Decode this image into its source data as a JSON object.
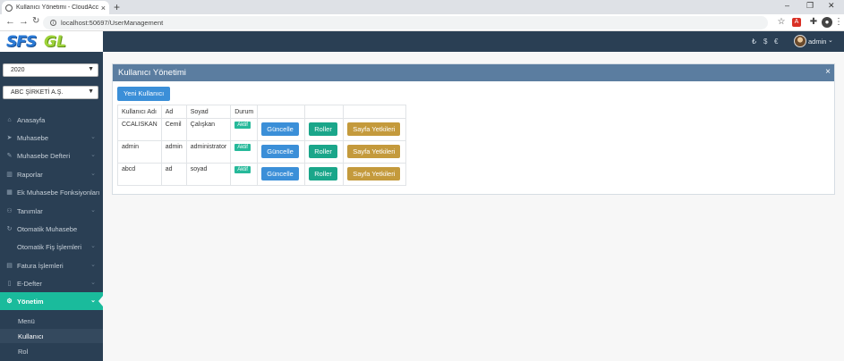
{
  "browser": {
    "tab_title": "Kullanıcı Yönetimi - CloudAccou",
    "tab_close": "×",
    "new_tab": "+",
    "url": "localhost:50697/UserManagement",
    "window_controls": [
      "–",
      "❐",
      "✕"
    ]
  },
  "brand": {
    "part1": "SFS",
    "part2": "GL"
  },
  "header": {
    "currencies": [
      "₺",
      "$",
      "€"
    ],
    "user": "admin"
  },
  "sidebar": {
    "year_select": "2020",
    "company_select": "ABC ŞİRKETİ A.Ş.",
    "items": [
      {
        "label": "Anasayfa",
        "icon": "home-icon",
        "has_arrow": false
      },
      {
        "label": "Muhasebe",
        "icon": "send-icon",
        "has_arrow": true
      },
      {
        "label": "Muhasebe Defteri",
        "icon": "pencil-icon",
        "has_arrow": true
      },
      {
        "label": "Raporlar",
        "icon": "bar-chart-icon",
        "has_arrow": true
      },
      {
        "label": "Ek Muhasebe Fonksiyonları",
        "icon": "table-icon",
        "has_arrow": false
      },
      {
        "label": "Tanımlar",
        "icon": "users-icon",
        "has_arrow": true
      },
      {
        "label": "Otomatik Muhasebe",
        "icon": "refresh-icon",
        "has_arrow": false
      },
      {
        "label": "Otomatik Fiş İşlemleri",
        "icon": "",
        "has_arrow": true
      },
      {
        "label": "Fatura İşlemleri",
        "icon": "file-icon",
        "has_arrow": true
      },
      {
        "label": "E-Defter",
        "icon": "book-icon",
        "has_arrow": true
      },
      {
        "label": "Yönetim",
        "icon": "cogs-icon",
        "has_arrow": true,
        "active": true
      }
    ],
    "subitems": [
      "Menü",
      "Kullanıcı",
      "Rol"
    ]
  },
  "panel": {
    "title": "Kullanıcı Yönetimi",
    "close": "×",
    "new_user_button": "Yeni Kullanıcı",
    "columns": [
      "Kullanıcı Adı",
      "Ad",
      "Soyad",
      "Durum",
      "",
      "",
      ""
    ],
    "rows": [
      {
        "username": "CCALISKAN",
        "name": "Cemil",
        "surname": "Çalışkan",
        "status": "Aktif"
      },
      {
        "username": "admin",
        "name": "admin",
        "surname": "administrator",
        "status": "Aktif"
      },
      {
        "username": "abcd",
        "name": "ad",
        "surname": "soyad",
        "status": "Aktif"
      }
    ],
    "actions": {
      "update": "Güncelle",
      "roles": "Roller",
      "page_permissions": "Sayfa Yetkileri"
    }
  },
  "colors": {
    "sidebar": "#2a3f54",
    "active": "#1abb9c",
    "panel_head": "#5b7da0",
    "blue_button": "#3b8fd8",
    "teal_button": "#1aa68a",
    "gold_button": "#c49a3c"
  }
}
